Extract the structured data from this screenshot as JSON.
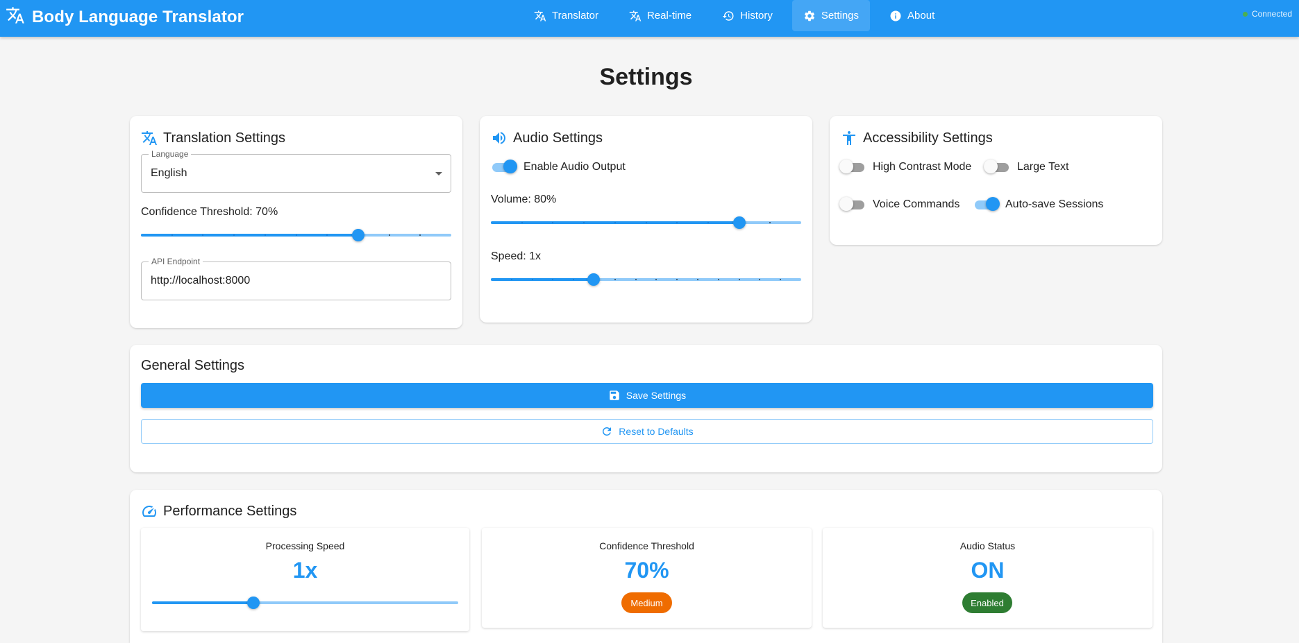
{
  "app": {
    "title": "Body Language Translator",
    "connection_status": "Connected"
  },
  "nav": [
    {
      "label": "Translator",
      "icon": "translate-icon",
      "active": false
    },
    {
      "label": "Real-time",
      "icon": "translate-icon",
      "active": false
    },
    {
      "label": "History",
      "icon": "history-icon",
      "active": false
    },
    {
      "label": "Settings",
      "icon": "gear-icon",
      "active": true
    },
    {
      "label": "About",
      "icon": "info-icon",
      "active": false
    }
  ],
  "page_title": "Settings",
  "translation": {
    "title": "Translation Settings",
    "language_label": "Language",
    "language_value": "English",
    "confidence_label": "Confidence Threshold: 70%",
    "confidence_value": 0.7,
    "api_label": "API Endpoint",
    "api_value": "http://localhost:8000"
  },
  "audio": {
    "title": "Audio Settings",
    "enable_label": "Enable Audio Output",
    "enable_on": true,
    "volume_label": "Volume: 80%",
    "volume_value": 0.8,
    "speed_label": "Speed: 1x",
    "speed_value": 1
  },
  "accessibility": {
    "title": "Accessibility Settings",
    "high_contrast_label": "High Contrast Mode",
    "high_contrast_on": false,
    "large_text_label": "Large Text",
    "large_text_on": false,
    "voice_commands_label": "Voice Commands",
    "voice_commands_on": false,
    "autosave_label": "Auto-save Sessions",
    "autosave_on": true
  },
  "general": {
    "title": "General Settings",
    "save_label": "Save Settings",
    "reset_label": "Reset to Defaults"
  },
  "performance": {
    "title": "Performance Settings",
    "processing_speed_title": "Processing Speed",
    "processing_speed_value": "1x",
    "confidence_title": "Confidence Threshold",
    "confidence_value": "70%",
    "confidence_chip": "Medium",
    "audio_status_title": "Audio Status",
    "audio_status_value": "ON",
    "audio_status_chip": "Enabled"
  },
  "colors": {
    "primary": "#2196f3",
    "chip_medium": "#ef6c00",
    "chip_enabled": "#2e7d32",
    "connected": "#4caf50"
  }
}
